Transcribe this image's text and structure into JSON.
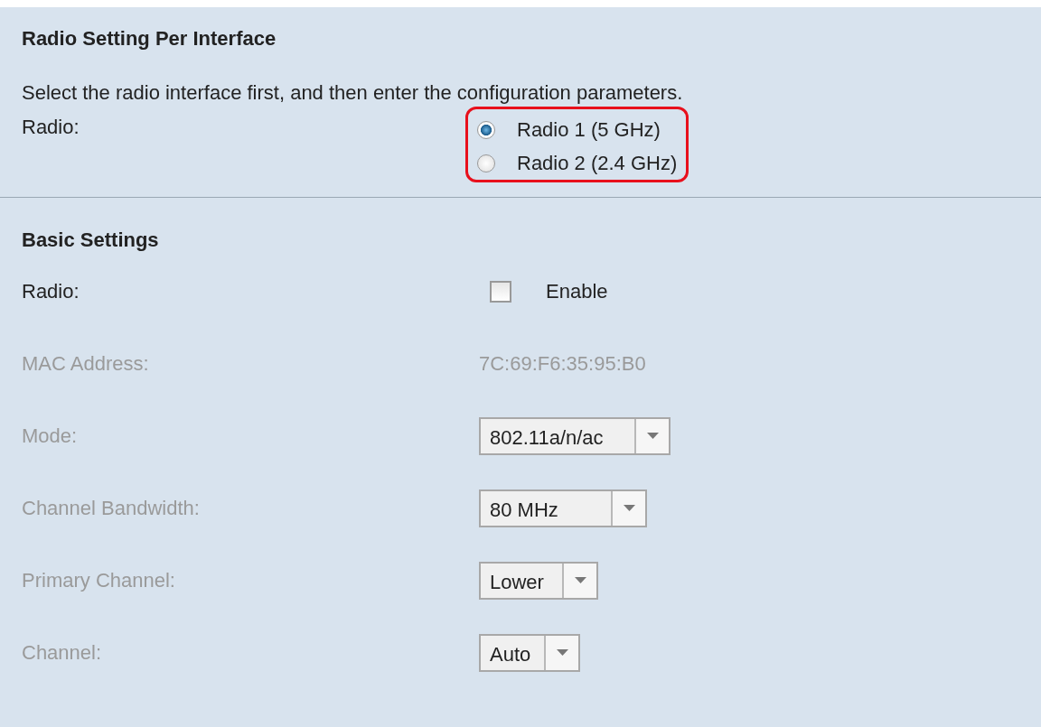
{
  "radio_section": {
    "title": "Radio Setting Per Interface",
    "description": "Select the radio interface first, and then enter the configuration parameters.",
    "label": "Radio:",
    "highlighted": true,
    "options": [
      {
        "label": "Radio 1 (5 GHz)",
        "selected": true
      },
      {
        "label": "Radio 2 (2.4 GHz)",
        "selected": false
      }
    ]
  },
  "basic_settings": {
    "title": "Basic Settings",
    "rows": [
      {
        "kind": "checkbox",
        "label": "Radio:",
        "disabled": false,
        "checked": false,
        "value": "Enable"
      },
      {
        "kind": "text",
        "label": "MAC Address:",
        "disabled": true,
        "value": "7C:69:F6:35:95:B0"
      },
      {
        "kind": "select",
        "label": "Mode:",
        "disabled": true,
        "value": "802.11a/n/ac"
      },
      {
        "kind": "select",
        "label": "Channel Bandwidth:",
        "disabled": true,
        "value": "80 MHz"
      },
      {
        "kind": "select",
        "label": "Primary Channel:",
        "disabled": true,
        "value": "Lower"
      },
      {
        "kind": "select",
        "label": "Channel:",
        "disabled": true,
        "value": "Auto"
      }
    ]
  }
}
